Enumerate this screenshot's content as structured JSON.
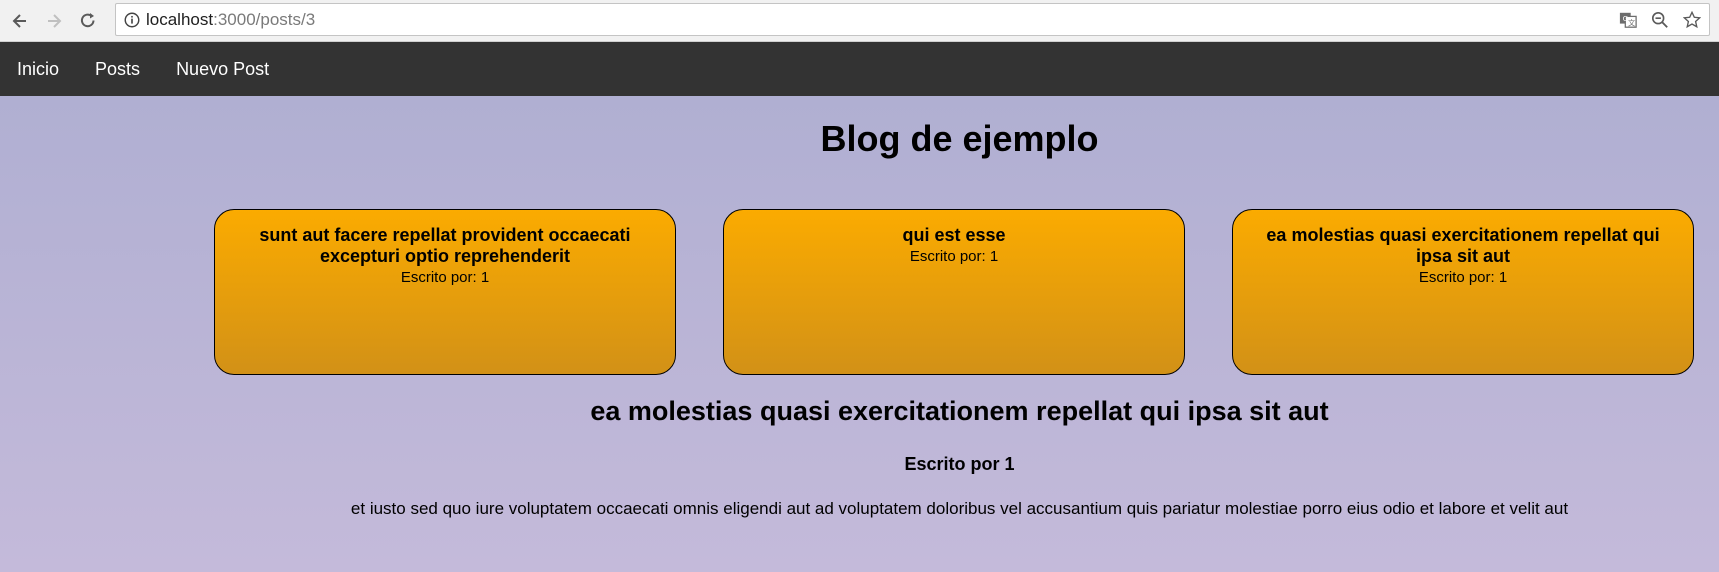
{
  "browser": {
    "url_host": "localhost",
    "url_rest": ":3000/posts/3"
  },
  "nav": {
    "items": [
      {
        "label": "Inicio"
      },
      {
        "label": "Posts"
      },
      {
        "label": "Nuevo Post"
      }
    ]
  },
  "page": {
    "title": "Blog de ejemplo"
  },
  "cards": [
    {
      "title": "sunt aut facere repellat provident occaecati excepturi optio reprehenderit",
      "author": "Escrito por: 1"
    },
    {
      "title": "qui est esse",
      "author": "Escrito por: 1"
    },
    {
      "title": "ea molestias quasi exercitationem repellat qui ipsa sit aut",
      "author": "Escrito por: 1"
    }
  ],
  "post": {
    "title": "ea molestias quasi exercitationem repellat qui ipsa sit aut",
    "author": "Escrito por 1",
    "body": "et iusto sed quo iure voluptatem occaecati omnis eligendi aut ad voluptatem doloribus vel accusantium quis pariatur molestiae porro eius odio et labore et velit aut"
  },
  "colors": {
    "navbar": "#333333",
    "card_top": "#fbab00",
    "card_bottom": "#d29117",
    "page_bg": "#b0afd2"
  }
}
